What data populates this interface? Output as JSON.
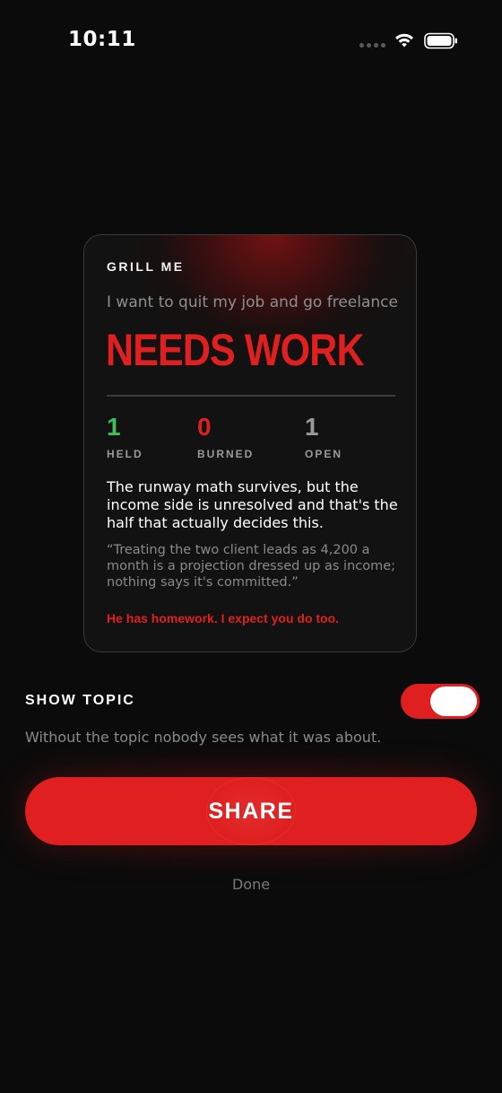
{
  "status_bar": {
    "time": "10:11"
  },
  "card": {
    "kicker": "GRILL ME",
    "topic": "I want to quit my job and go freelance",
    "verdict": "NEEDS WORK",
    "stats": [
      {
        "value": "1",
        "label": "HELD",
        "color": "#3fbf5a"
      },
      {
        "value": "0",
        "label": "BURNED",
        "color": "#e02020"
      },
      {
        "value": "1",
        "label": "OPEN",
        "color": "#9a9a9a"
      }
    ],
    "summary": "The runway math survives, but the income side is unresolved and that's the half that actually decides this.",
    "quote": "“Treating the two client leads as 4,200 a month is a projection dressed up as income; nothing says it's committed.”",
    "homework": "He has homework. I expect you do too."
  },
  "show_topic": {
    "label": "SHOW TOPIC",
    "enabled": true,
    "help_text": "Without the topic nobody sees what it was about."
  },
  "actions": {
    "share_label": "SHARE",
    "done_label": "Done"
  },
  "colors": {
    "accent": "#e02020",
    "background": "#0b0b0b",
    "held": "#3fbf5a"
  },
  "icons": {
    "wifi": "wifi-icon",
    "battery": "battery-icon",
    "signal": "signal-dots-icon"
  }
}
